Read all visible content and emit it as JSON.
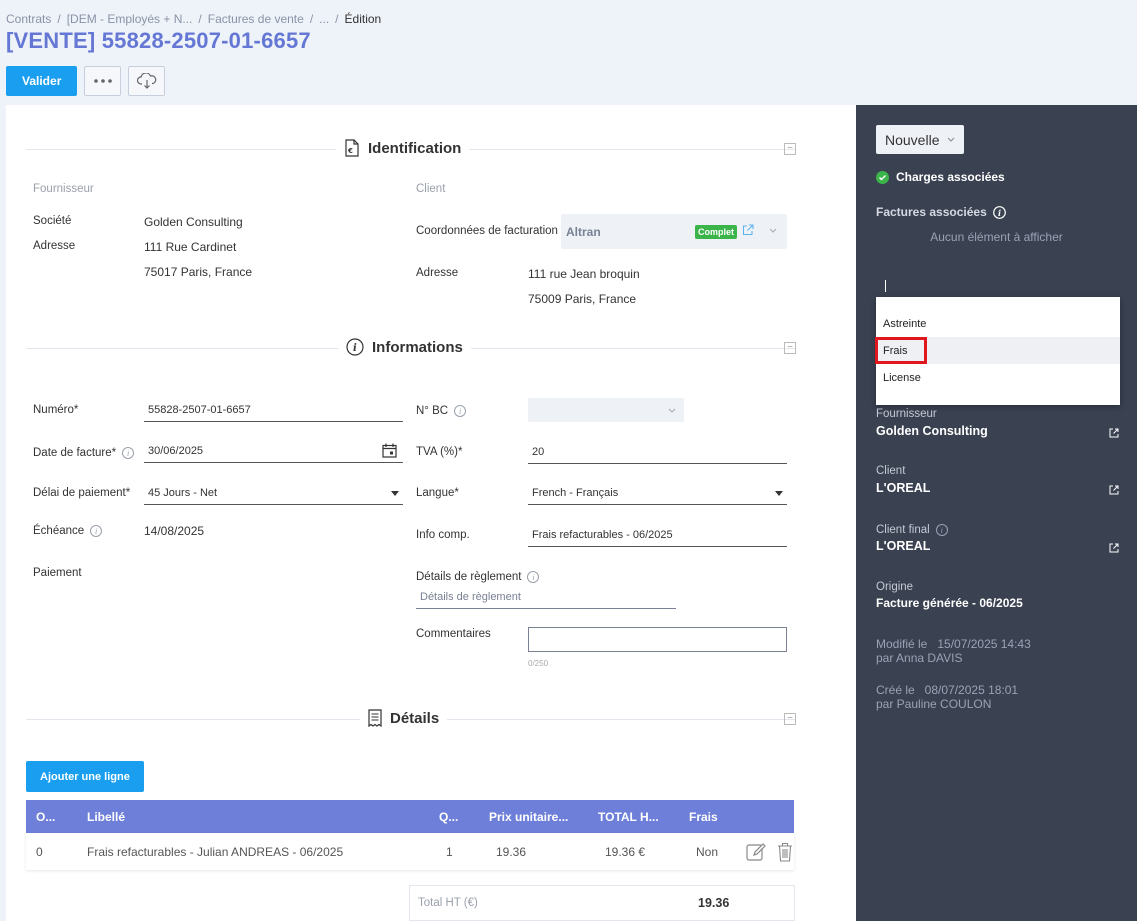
{
  "breadcrumb": {
    "items": [
      "Contrats",
      "[DEM - Employés + N...",
      "Factures de vente",
      "..."
    ],
    "current": "Édition"
  },
  "page_title": "[VENTE] 55828-2507-01-6657",
  "toolbar": {
    "validate_label": "Valider",
    "more_icon": "more-horizontal-icon",
    "download_icon": "cloud-download-icon"
  },
  "identification": {
    "title": "Identification",
    "fournisseur_heading": "Fournisseur",
    "societe_label": "Société",
    "societe_value": "Golden Consulting",
    "adresse_label": "Adresse",
    "adresse_line1": "111 Rue Cardinet",
    "adresse_line2": "75017 Paris, France",
    "client_heading": "Client",
    "coord_label": "Coordonnées de facturation",
    "coord_value": "Altran",
    "coord_badge": "Complet",
    "client_adresse_label": "Adresse",
    "client_adresse_line1": "111 rue Jean broquin",
    "client_adresse_line2": "75009 Paris, France"
  },
  "informations": {
    "title": "Informations",
    "numero_label": "Numéro*",
    "numero_value": "55828-2507-01-6657",
    "date_label": "Date de facture*",
    "date_value": "30/06/2025",
    "delai_label": "Délai de paiement*",
    "delai_value": "45 Jours - Net",
    "echeance_label": "Échéance",
    "echeance_value": "14/08/2025",
    "paiement_label": "Paiement",
    "nbc_label": "N° BC",
    "tva_label": "TVA (%)*",
    "tva_value": "20",
    "langue_label": "Langue*",
    "langue_value": "French - Français",
    "info_label": "Info comp.",
    "info_value": "Frais refacturables - 06/2025",
    "details_label": "Détails de règlement",
    "details_placeholder": "Détails de règlement",
    "commentaires_label": "Commentaires",
    "commentaires_counter": "0/250"
  },
  "details": {
    "title": "Détails",
    "add_line_label": "Ajouter une ligne",
    "columns": [
      "O...",
      "Libellé",
      "Q...",
      "Prix unitaire...",
      "TOTAL H...",
      "Frais"
    ],
    "rows": [
      {
        "ordre": "0",
        "libelle": "Frais refacturables - Julian ANDREAS - 06/2025",
        "qte": "1",
        "prix": "19.36",
        "total": "19.36 €",
        "frais": "Non"
      }
    ],
    "total_label": "Total HT (€)",
    "total_value": "19.36"
  },
  "sidebar": {
    "nouvelle_label": "Nouvelle",
    "charges_label": "Charges associées",
    "factures_label": "Factures associées",
    "empty_label": "Aucun élément à afficher",
    "dropdown_options": [
      "Astreinte",
      "Frais",
      "License"
    ],
    "fournisseur_label": "Fournisseur",
    "fournisseur_value": "Golden Consulting",
    "client_label": "Client",
    "client_value": "L'OREAL",
    "client_final_label": "Client final",
    "client_final_value": "L'OREAL",
    "origine_label": "Origine",
    "origine_value": "Facture générée - 06/2025",
    "modifie_line1": "Modifié le   15/07/2025 14:43",
    "modifie_line2": "par Anna DAVIS",
    "cree_line1": "Créé le   08/07/2025 18:01",
    "cree_line2": "par Pauline COULON"
  },
  "colors": {
    "accent": "#1a9ff0",
    "title": "#6577d4",
    "table_header": "#6d7fd8",
    "sidebar": "#3a4151",
    "success": "#3bb54a",
    "highlight": "#e0171d"
  }
}
